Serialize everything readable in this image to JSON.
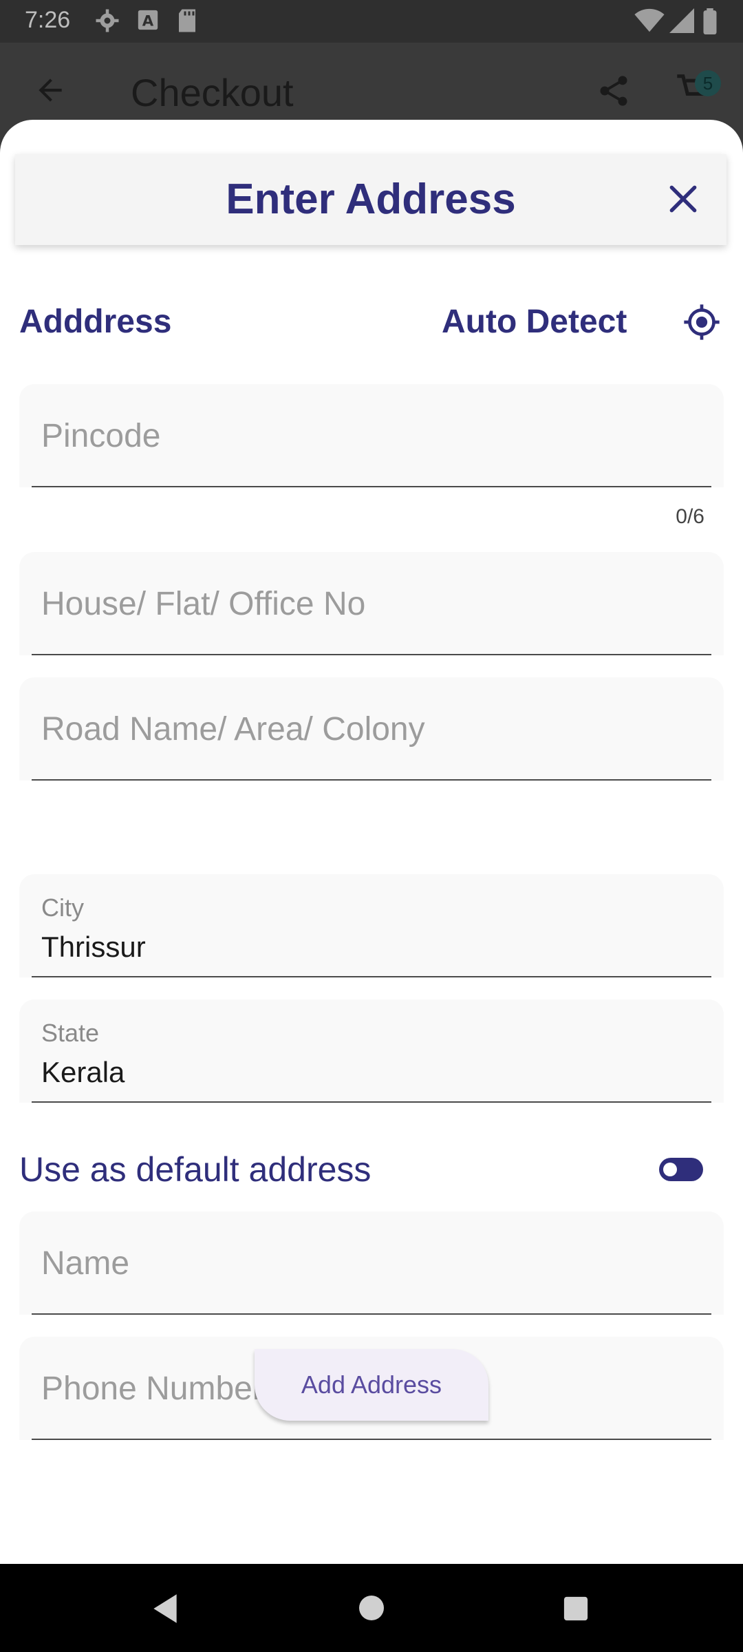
{
  "status_bar": {
    "time": "7:26",
    "icons": [
      "gear-icon",
      "text-a-icon",
      "sd-card-icon",
      "wifi-icon",
      "signal-icon",
      "battery-icon"
    ]
  },
  "app_bar": {
    "title": "Checkout",
    "cart_badge": "5"
  },
  "sheet": {
    "title": "Enter Address",
    "section_title": "Adddress",
    "auto_detect_label": "Auto Detect"
  },
  "fields": {
    "pincode": {
      "placeholder": "Pincode",
      "value": "",
      "counter": "0/6"
    },
    "house": {
      "placeholder": "House/ Flat/ Office No",
      "value": ""
    },
    "road": {
      "placeholder": "Road Name/ Area/ Colony",
      "value": ""
    },
    "city": {
      "label": "City",
      "value": "Thrissur"
    },
    "state": {
      "label": "State",
      "value": "Kerala"
    },
    "name": {
      "placeholder": "Name",
      "value": ""
    },
    "phone": {
      "placeholder": "Phone Number",
      "value": ""
    }
  },
  "default_toggle": {
    "label": "Use as default address",
    "on": true
  },
  "actions": {
    "add_address_label": "Add Address"
  },
  "colors": {
    "accent": "#2f2e7b",
    "button_bg": "#f2eef8",
    "button_text": "#5a4ca0"
  }
}
